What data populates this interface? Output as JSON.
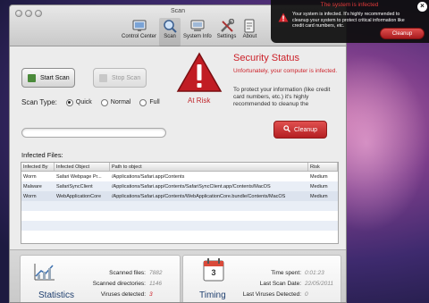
{
  "window": {
    "title": "Scan"
  },
  "toolbar": {
    "items": [
      {
        "label": "Control Center",
        "icon": "control-center-icon"
      },
      {
        "label": "Scan",
        "icon": "scan-icon"
      },
      {
        "label": "System Info",
        "icon": "system-info-icon"
      },
      {
        "label": "Settings",
        "icon": "settings-icon"
      },
      {
        "label": "About",
        "icon": "about-icon"
      }
    ]
  },
  "controls": {
    "start_label": "Start Scan",
    "stop_label": "Stop Scan",
    "scan_type_label": "Scan Type:",
    "scan_types": [
      "Quick",
      "Normal",
      "Full"
    ],
    "selected_scan_type": "Quick",
    "progress_fraction": 0
  },
  "security": {
    "status_word": "At Risk",
    "title": "Security Status",
    "subtitle": "Unfortunately, your computer is infected.",
    "body": "To protect your information (like credit card numbers, etc.) it's highly recommended to cleanup the",
    "cleanup_label": "Cleanup"
  },
  "infected": {
    "label": "Infected Files:",
    "columns": [
      "Infected By",
      "Infected Object",
      "Path to object",
      "Risk"
    ],
    "rows": [
      [
        "Worm",
        "Safari Webpage Pr...",
        "/Applications/Safari.app/Contents",
        "Medium"
      ],
      [
        "Malware",
        "SafariSyncClient",
        "/Applications/Safari.app/Contents/SafariSyncClient.app/Contents/MacOS",
        "Medium"
      ],
      [
        "Worm",
        "WebApplicationCore",
        "/Applications/Safari.app/Contents/WebApplicationCore.bundle/Contents/MacOS",
        "Medium"
      ]
    ]
  },
  "statistics": {
    "title": "Statistics",
    "scanned_files_label": "Scanned files:",
    "scanned_files": "7882",
    "scanned_dirs_label": "Scanned directories:",
    "scanned_dirs": "1146",
    "viruses_label": "Viruses detected:",
    "viruses": "3"
  },
  "timing": {
    "title": "Timing",
    "time_spent_label": "Time spent:",
    "time_spent": "0:01:23",
    "last_scan_label": "Last Scan Date:",
    "last_scan": "22/05/2011",
    "last_viruses_label": "Last Viruses Detected:",
    "last_viruses": "0",
    "calendar_day": "3"
  },
  "popup": {
    "title": "The system is infected",
    "message": "Your system is infected. It's highly recommended to cleanup your system to protect critical information like credit card numbers, etc.",
    "button_label": "Cleanup",
    "close_glyph": "×"
  },
  "colors": {
    "alert_red": "#cc2129",
    "accent_blue": "#1f3f6f",
    "start_icon_green": "#4a8a3a"
  }
}
